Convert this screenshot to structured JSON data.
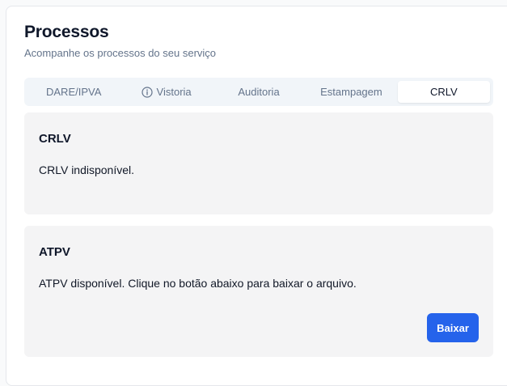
{
  "header": {
    "title": "Processos",
    "subtitle": "Acompanhe os processos do seu serviço"
  },
  "tabs": [
    {
      "label": "DARE/IPVA",
      "icon": null,
      "active": false
    },
    {
      "label": "Vistoria",
      "icon": "info-icon",
      "active": false
    },
    {
      "label": "Auditoria",
      "icon": null,
      "active": false
    },
    {
      "label": "Estampagem",
      "icon": null,
      "active": false
    },
    {
      "label": "CRLV",
      "icon": null,
      "active": true
    }
  ],
  "panels": {
    "crlv": {
      "title": "CRLV",
      "text": "CRLV indisponível."
    },
    "atpv": {
      "title": "ATPV",
      "text": "ATPV disponível. Clique no botão abaixo para baixar o arquivo.",
      "button_label": "Baixar"
    }
  },
  "colors": {
    "accent": "#2563eb",
    "panel_bg": "#f4f4f5",
    "tabs_bg": "#f1f5f9",
    "muted_text": "#64748b"
  }
}
